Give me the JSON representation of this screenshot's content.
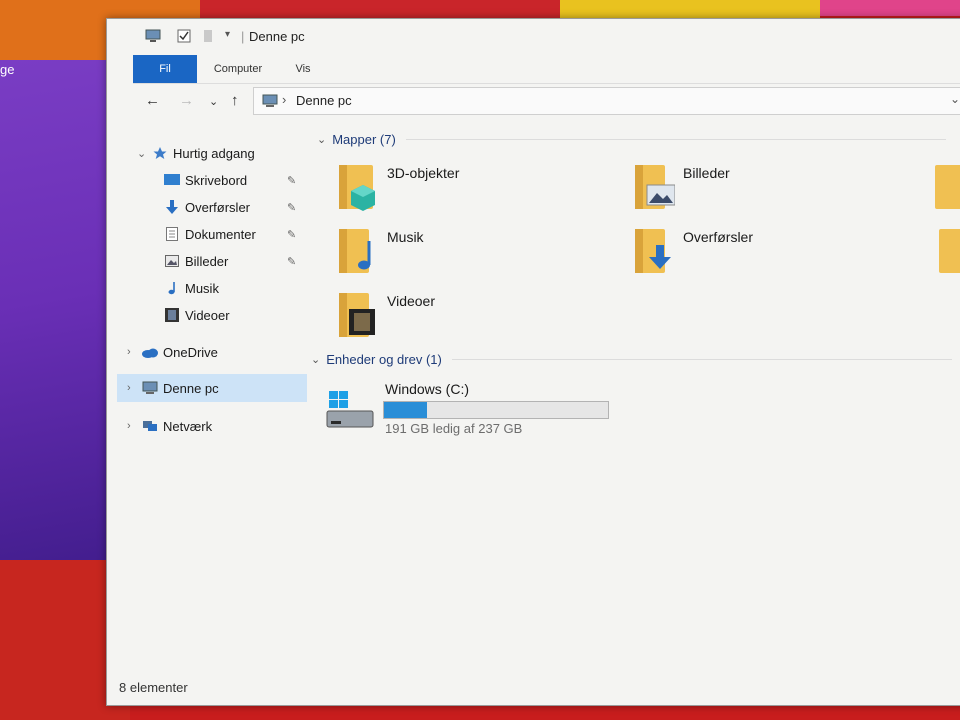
{
  "desktop": {
    "label": "ge"
  },
  "window": {
    "title": "Denne pc",
    "ribbon_tabs": [
      {
        "label": "Fil",
        "active": true
      },
      {
        "label": "Computer",
        "active": false
      },
      {
        "label": "Vis",
        "active": false
      }
    ],
    "address": {
      "path": "Denne pc"
    }
  },
  "nav": {
    "quick_access": "Hurtig adgang",
    "items": [
      {
        "label": "Skrivebord",
        "icon": "desktop-icon",
        "pinned": true
      },
      {
        "label": "Overførsler",
        "icon": "download-arrow-icon",
        "pinned": true
      },
      {
        "label": "Dokumenter",
        "icon": "document-icon",
        "pinned": true
      },
      {
        "label": "Billeder",
        "icon": "pictures-icon",
        "pinned": true
      },
      {
        "label": "Musik",
        "icon": "music-note-icon",
        "pinned": false
      },
      {
        "label": "Videoer",
        "icon": "film-icon",
        "pinned": false
      }
    ],
    "onedrive": "OneDrive",
    "this_pc": "Denne pc",
    "network": "Netværk"
  },
  "content": {
    "folders_header": "Mapper (7)",
    "folders": [
      {
        "name": "3D-objekter",
        "icon": "3d-objects-folder-icon"
      },
      {
        "name": "Billeder",
        "icon": "pictures-folder-icon"
      },
      {
        "name": "Musik",
        "icon": "music-folder-icon"
      },
      {
        "name": "Overførsler",
        "icon": "downloads-folder-icon"
      },
      {
        "name": "Videoer",
        "icon": "videos-folder-icon"
      }
    ],
    "devices_header": "Enheder og drev (1)",
    "drive": {
      "name": "Windows (C:)",
      "free_text": "191 GB ledig af 237 GB",
      "used_fraction": 0.194,
      "icon": "windows-drive-icon"
    }
  },
  "status": {
    "text": "8 elementer"
  },
  "colors": {
    "accent": "#1a66c4",
    "selection": "#cde3f7",
    "drive_fill": "#2a8ed7",
    "header_text": "#1e3b78"
  }
}
